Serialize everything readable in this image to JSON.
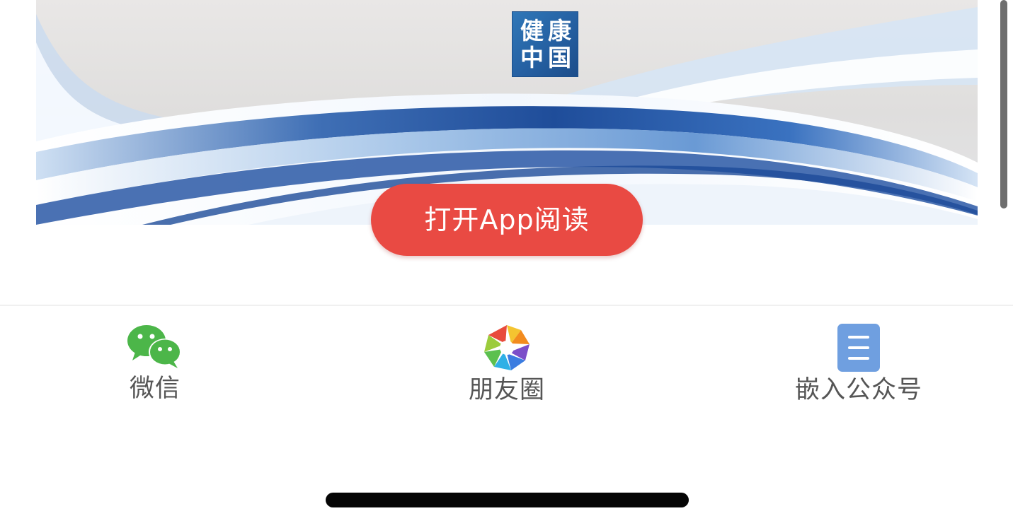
{
  "banner": {
    "logo": {
      "chars": [
        "健",
        "康",
        "中",
        "国"
      ],
      "bg_color": "#2560a2"
    }
  },
  "open_app_button": {
    "label": "打开App阅读",
    "color": "#e94a43"
  },
  "share_bar": {
    "items": [
      {
        "label": "微信",
        "icon": "wechat-icon",
        "color": "#4cb649"
      },
      {
        "label": "朋友圈",
        "icon": "moments-icon"
      },
      {
        "label": "嵌入公众号",
        "icon": "document-icon",
        "color": "#6f9fe0"
      }
    ]
  }
}
